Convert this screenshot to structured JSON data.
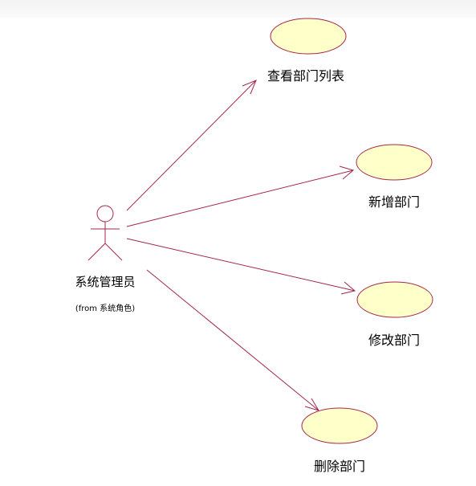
{
  "colors": {
    "line": "#a3284a",
    "use_case_fill": "#ffffca",
    "use_case_stroke": "#a3284a",
    "actor_stroke": "#a3284a",
    "background": "#ffffff"
  },
  "actor": {
    "name": "系统管理员",
    "package": "(from 系统角色)",
    "icon": "stick-figure-actor-icon"
  },
  "use_cases": [
    {
      "id": "uc-view-list",
      "label": "查看部门列表"
    },
    {
      "id": "uc-add",
      "label": "新增部门"
    },
    {
      "id": "uc-edit",
      "label": "修改部门"
    },
    {
      "id": "uc-delete",
      "label": "删除部门"
    }
  ],
  "associations": [
    {
      "from": "actor",
      "to": "uc-view-list"
    },
    {
      "from": "actor",
      "to": "uc-add"
    },
    {
      "from": "actor",
      "to": "uc-edit"
    },
    {
      "from": "actor",
      "to": "uc-delete"
    }
  ]
}
